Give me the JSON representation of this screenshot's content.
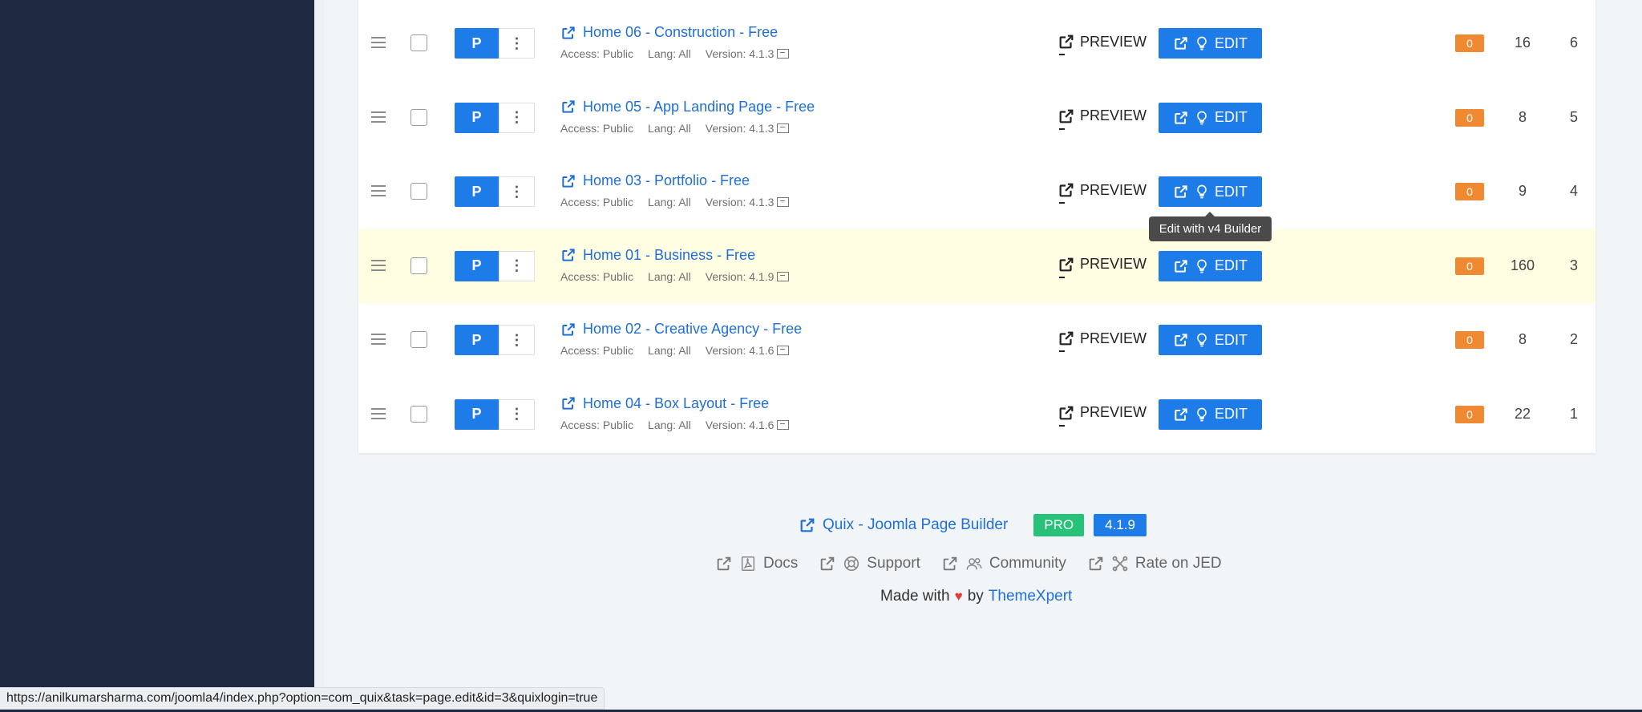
{
  "rows": [
    {
      "title": "Home 06 - Construction - Free",
      "access": "Access: Public",
      "lang": "Lang: All",
      "version": "Version: 4.1.3",
      "status": "P",
      "preview": "PREVIEW",
      "edit": "EDIT",
      "badge": "0",
      "hits": "16",
      "id": "6",
      "highlight": false
    },
    {
      "title": "Home 05 - App Landing Page - Free",
      "access": "Access: Public",
      "lang": "Lang: All",
      "version": "Version: 4.1.3",
      "status": "P",
      "preview": "PREVIEW",
      "edit": "EDIT",
      "badge": "0",
      "hits": "8",
      "id": "5",
      "highlight": false
    },
    {
      "title": "Home 03 - Portfolio - Free",
      "access": "Access: Public",
      "lang": "Lang: All",
      "version": "Version: 4.1.3",
      "status": "P",
      "preview": "PREVIEW",
      "edit": "EDIT",
      "badge": "0",
      "hits": "9",
      "id": "4",
      "highlight": false
    },
    {
      "title": "Home 01 - Business - Free",
      "access": "Access: Public",
      "lang": "Lang: All",
      "version": "Version: 4.1.9",
      "status": "P",
      "preview": "PREVIEW",
      "edit": "EDIT",
      "badge": "0",
      "hits": "160",
      "id": "3",
      "highlight": true
    },
    {
      "title": "Home 02 - Creative Agency - Free",
      "access": "Access: Public",
      "lang": "Lang: All",
      "version": "Version: 4.1.6",
      "status": "P",
      "preview": "PREVIEW",
      "edit": "EDIT",
      "badge": "0",
      "hits": "8",
      "id": "2",
      "highlight": false
    },
    {
      "title": "Home 04 - Box Layout - Free",
      "access": "Access: Public",
      "lang": "Lang: All",
      "version": "Version: 4.1.6",
      "status": "P",
      "preview": "PREVIEW",
      "edit": "EDIT",
      "badge": "0",
      "hits": "22",
      "id": "1",
      "highlight": false
    }
  ],
  "tooltip": "Edit with v4 Builder",
  "footer": {
    "product_link": "Quix - Joomla Page Builder",
    "pro_badge": "PRO",
    "version_badge": "4.1.9",
    "links": {
      "docs": "Docs",
      "support": "Support",
      "community": "Community",
      "rate": "Rate on JED"
    },
    "made_with": "Made with",
    "by": "by",
    "brand": "ThemeXpert"
  },
  "status_url": "https://anilkumarsharma.com/joomla4/index.php?option=com_quix&task=page.edit&id=3&quixlogin=true",
  "colors": {
    "sidebar": "#1d2a41",
    "primary": "#1e7ce8",
    "badge_orange": "#f08a32",
    "pro_green": "#27c178",
    "highlight_row": "#fffde2"
  }
}
